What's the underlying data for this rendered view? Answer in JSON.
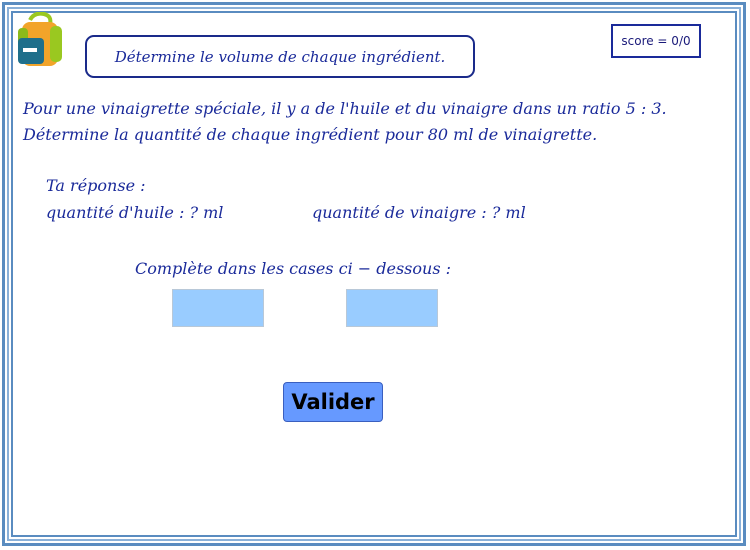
{
  "header": {
    "title": "Détermine le volume de chaque ingrédient.",
    "score": "score = 0/0",
    "logo_icon": "backpack-icon"
  },
  "problem": {
    "line1": "Pour une vinaigrette spéciale, il y a de l'huile et du vinaigre dans un ratio 5 : 3.",
    "line2": "Détermine la quantité de chaque ingrédient pour 80 ml de vinaigrette."
  },
  "answer": {
    "label": "Ta réponse :",
    "oil": "quantité d'huile : ? ml",
    "vinegar": "quantité de vinaigre : ? ml"
  },
  "instruction": "Complète dans les cases ci − dessous :",
  "inputs": {
    "oil_value": "",
    "vinegar_value": ""
  },
  "validate_label": "Valider",
  "colors": {
    "text": "#1a2a9a",
    "input_bg": "#99ccff",
    "button_bg": "#6699ff",
    "frame": "#5a8cc0"
  }
}
